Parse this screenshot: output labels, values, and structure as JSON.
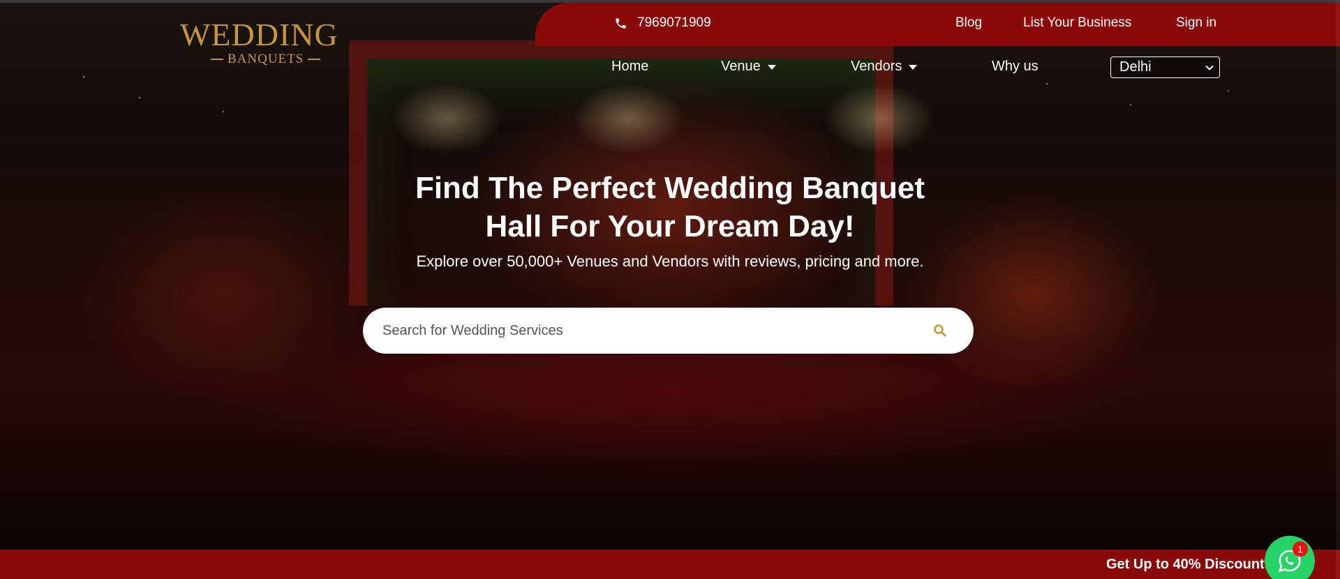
{
  "header": {
    "logo": {
      "main": "WEDDING",
      "sub": "BANQUETS"
    },
    "phone": "7969071909",
    "links": [
      "Blog",
      "List Your Business",
      "Sign in"
    ],
    "nav": [
      "Home",
      "Venue",
      "Vendors",
      "Why us"
    ],
    "city_selected": "Delhi"
  },
  "hero": {
    "headline_line1": "Find The Perfect Wedding Banquet",
    "headline_line2": "Hall For Your Dream Day!",
    "subline": "Explore over 50,000+ Venues and Vendors with reviews, pricing and more.",
    "search_placeholder": "Search for Wedding Services"
  },
  "promo": {
    "text": "Get Up to 40% Discount"
  },
  "whatsapp": {
    "badge": "1"
  },
  "colors": {
    "brand_red": "#8a0a0a",
    "gold": "#c8963a",
    "whatsapp_green": "#25d366"
  },
  "icons": [
    "phone-icon",
    "chevron-down-icon",
    "search-icon",
    "whatsapp-icon"
  ]
}
